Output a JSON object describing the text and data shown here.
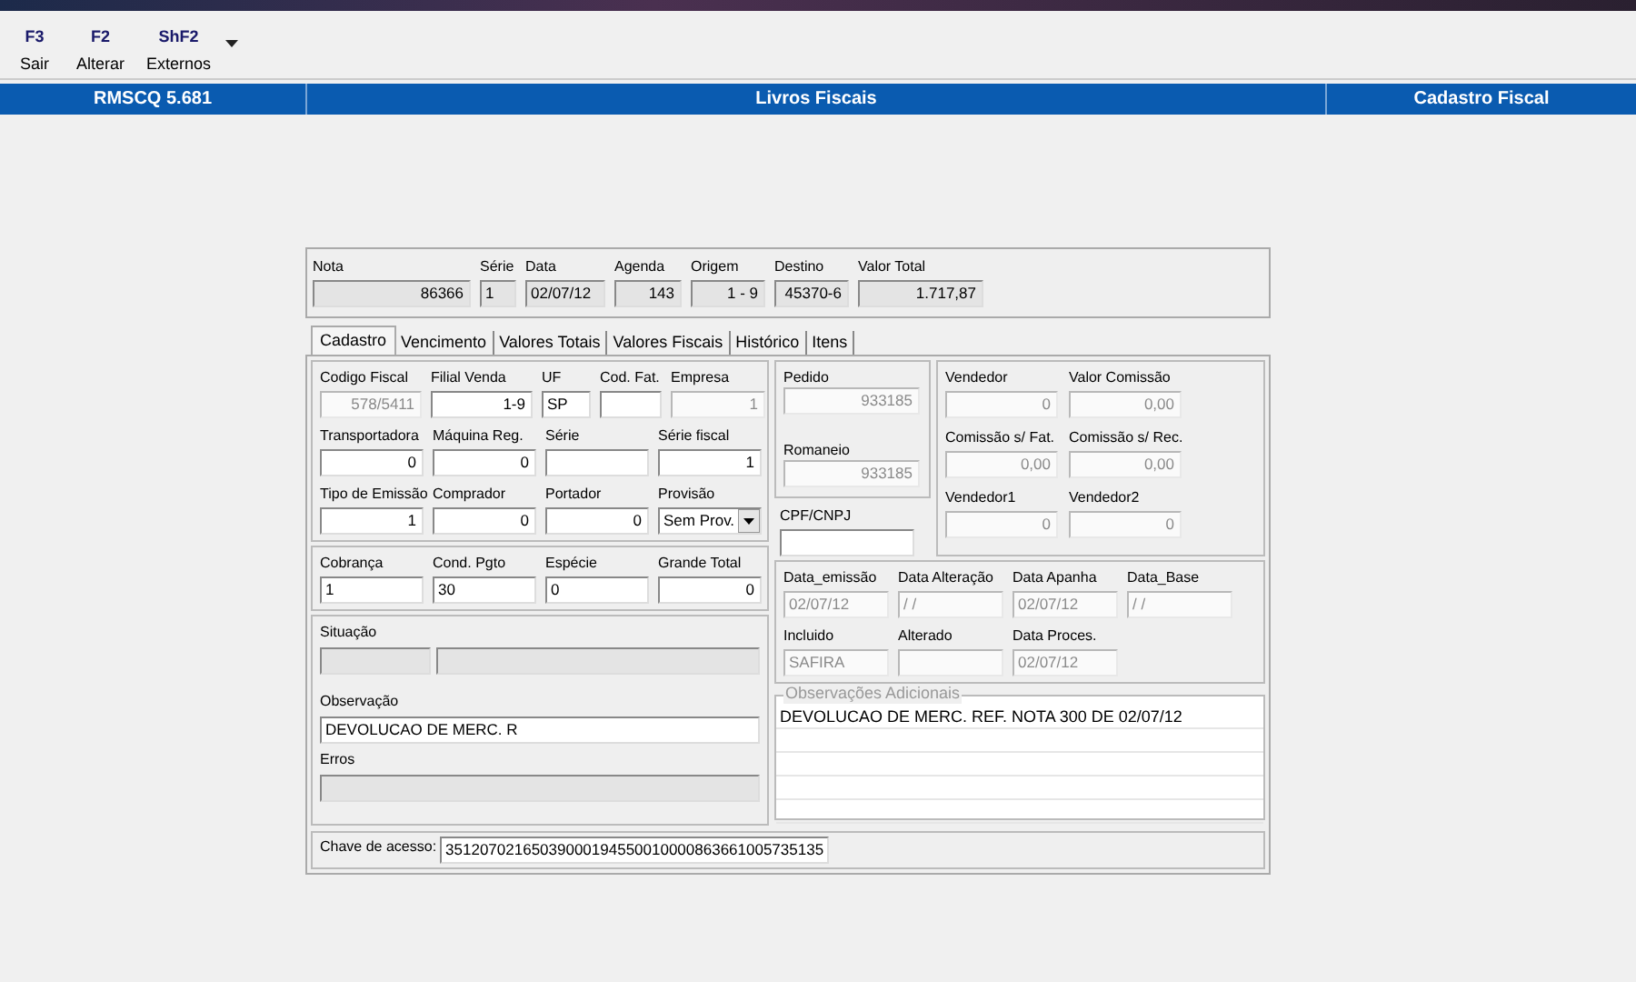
{
  "toolbar": [
    {
      "key": "F3",
      "label": "Sair"
    },
    {
      "key": "F2",
      "label": "Alterar"
    },
    {
      "key": "ShF2",
      "label": "Externos"
    }
  ],
  "header_bar": {
    "version": "RMSCQ 5.681",
    "title": "Livros Fiscais",
    "section": "Cadastro Fiscal"
  },
  "nota": [
    {
      "label": "Nota",
      "value": "86366",
      "kind": "number"
    },
    {
      "label": "Série",
      "value": "1"
    },
    {
      "label": "Data",
      "value": "02/07/12"
    },
    {
      "label": "Agenda",
      "value": "143",
      "kind": "number"
    },
    {
      "label": "Origem",
      "value": "1 - 9",
      "kind": "number"
    },
    {
      "label": "Destino",
      "value": "45370-6",
      "kind": "number"
    },
    {
      "label": "Valor Total",
      "value": "1.717,87",
      "kind": "number"
    }
  ],
  "tabs": [
    {
      "label": "Cadastro",
      "selected": true
    },
    {
      "label": "Vencimento",
      "selected": false
    },
    {
      "label": "Valores Totais",
      "selected": false
    },
    {
      "label": "Valores Fiscais",
      "selected": false
    },
    {
      "label": "Histórico",
      "selected": false
    },
    {
      "label": "Itens",
      "selected": false
    }
  ],
  "main_rows": [
    [
      {
        "label": "Codigo Fiscal",
        "value": "578/5411",
        "kind": "number",
        "disabled": true
      },
      {
        "label": "Filial Venda",
        "value": "1-9",
        "kind": "number",
        "disabled": false
      },
      {
        "label": "UF",
        "value": "SP",
        "disabled": false
      },
      {
        "label": "Cod. Fat.",
        "disabled": false
      },
      {
        "label": "Empresa",
        "value": "1",
        "kind": "number",
        "disabled": true
      }
    ],
    [
      {
        "label": "Transportadora",
        "value": "0",
        "kind": "number",
        "disabled": false
      },
      {
        "label": "Máquina Reg.",
        "value": "0",
        "kind": "number",
        "disabled": false
      },
      {
        "label": "Série",
        "disabled": false
      },
      {
        "label": "Série fiscal",
        "value": "1",
        "kind": "number",
        "disabled": false
      }
    ],
    [
      {
        "label": "Tipo de Emissão",
        "value": "1",
        "kind": "number",
        "disabled": false
      },
      {
        "label": "Comprador",
        "value": "0",
        "kind": "number",
        "disabled": false
      },
      {
        "label": "Portador",
        "value": "0",
        "kind": "number",
        "disabled": false
      },
      {
        "label": "Provisão",
        "value": "Sem Prov.",
        "kind": "dropdown",
        "disabled": false
      }
    ]
  ],
  "payment_row": [
    {
      "label": "Cobrança",
      "value": "1",
      "disabled": false
    },
    {
      "label": "Cond. Pgto",
      "value": "30",
      "disabled": false
    },
    {
      "label": "Espécie",
      "value": "0",
      "disabled": false
    },
    {
      "label": "Grande Total",
      "value": "0",
      "kind": "number",
      "disabled": false
    }
  ],
  "situacao": {
    "label": "Situação"
  },
  "observacao": {
    "label": "Observação",
    "value": "DEVOLUCAO DE MERC. R"
  },
  "erros": {
    "label": "Erros"
  },
  "pedido_box": [
    {
      "label": "Pedido",
      "value": "933185",
      "kind": "number",
      "disabled": true
    },
    {
      "label": "Romaneio",
      "value": "933185",
      "kind": "number",
      "disabled": true
    }
  ],
  "cpf": {
    "label": "CPF/CNPJ",
    "disabled": false
  },
  "vendedor_rows": [
    [
      {
        "label": "Vendedor",
        "value": "0",
        "kind": "number",
        "disabled": true
      },
      {
        "label": "Valor Comissão",
        "value": "0,00",
        "kind": "number",
        "disabled": true
      }
    ],
    [
      {
        "label": "Comissão s/ Fat.",
        "value": "0,00",
        "kind": "number",
        "disabled": true
      },
      {
        "label": "Comissão s/ Rec.",
        "value": "0,00",
        "kind": "number",
        "disabled": true
      }
    ],
    [
      {
        "label": "Vendedor1",
        "value": "0",
        "kind": "number",
        "disabled": true
      },
      {
        "label": "Vendedor2",
        "value": "0",
        "kind": "number",
        "disabled": true
      }
    ]
  ],
  "date_rows": [
    [
      {
        "label": "Data_emissão",
        "value": "02/07/12",
        "disabled": true
      },
      {
        "label": "Data Alteração",
        "value": " /  /",
        "disabled": true
      },
      {
        "label": "Data Apanha",
        "value": "02/07/12",
        "disabled": true
      },
      {
        "label": "Data_Base",
        "value": " /  /",
        "disabled": true
      }
    ],
    [
      {
        "label": "Incluido",
        "value": "SAFIRA",
        "disabled": true
      },
      {
        "label": "Alterado",
        "disabled": true
      },
      {
        "label": "Data Proces.",
        "value": "02/07/12",
        "disabled": true
      }
    ]
  ],
  "observacoes_adicionais": {
    "title": "Observações Adicionais",
    "lines": [
      "DEVOLUCAO DE MERC. REF. NOTA 300 DE 02/07/12"
    ]
  },
  "chave": {
    "label": "Chave de acesso:",
    "value": "35120702165039000194550010000863661005735135"
  }
}
